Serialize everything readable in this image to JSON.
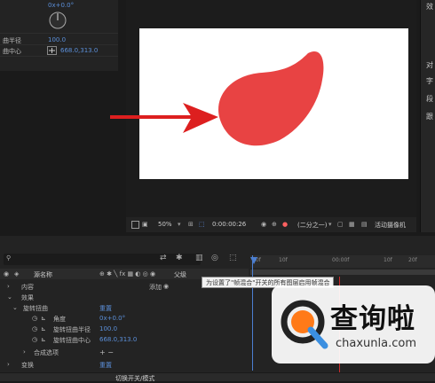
{
  "effect_controls": {
    "angle_value": "0x+0.0°",
    "rows": [
      {
        "label": "曲半径",
        "value": "100.0"
      },
      {
        "label": "曲中心",
        "value": "668.0,313.0"
      }
    ]
  },
  "viewer": {
    "zoom": "50%",
    "timecode": "0:00:00:26",
    "resolution": "(二分之一)",
    "camera": "活动摄像机"
  },
  "right_panel": [
    "效",
    "对",
    "字",
    "段",
    "跟"
  ],
  "timeline": {
    "ruler_marks": [
      "00f",
      "10f",
      "00:00f",
      "10f",
      "20f"
    ],
    "header": {
      "source_name": "源名称",
      "parent": "父级"
    },
    "tooltip": "为设置了\"帧混合\"开关的所有图层启用帧混合",
    "rows": [
      {
        "indent": 1,
        "arrow": "›",
        "label": "内容",
        "right": "添加"
      },
      {
        "indent": 1,
        "arrow": "⌄",
        "label": "效果",
        "right": ""
      },
      {
        "indent": 2,
        "arrow": "⌄",
        "label": "旋转扭曲",
        "right": "重置"
      },
      {
        "indent": 4,
        "arrow": "",
        "label": "角度",
        "right": "0x+0.0°"
      },
      {
        "indent": 4,
        "arrow": "",
        "label": "旋转扭曲半径",
        "right": "100.0"
      },
      {
        "indent": 4,
        "arrow": "",
        "label": "旋转扭曲中心",
        "right": "668.0,313.0"
      },
      {
        "indent": 3,
        "arrow": "›",
        "label": "合成选项",
        "right": "+ −"
      },
      {
        "indent": 1,
        "arrow": "›",
        "label": "变换",
        "right": "重置"
      }
    ],
    "toggle_label": "切换开关/模式"
  },
  "watermark": {
    "title": "查询啦",
    "url": "chaxunla.com"
  },
  "colors": {
    "blob": "#e84343",
    "arrow": "#dd1f1f",
    "accent_blue": "#5b8fd9"
  }
}
